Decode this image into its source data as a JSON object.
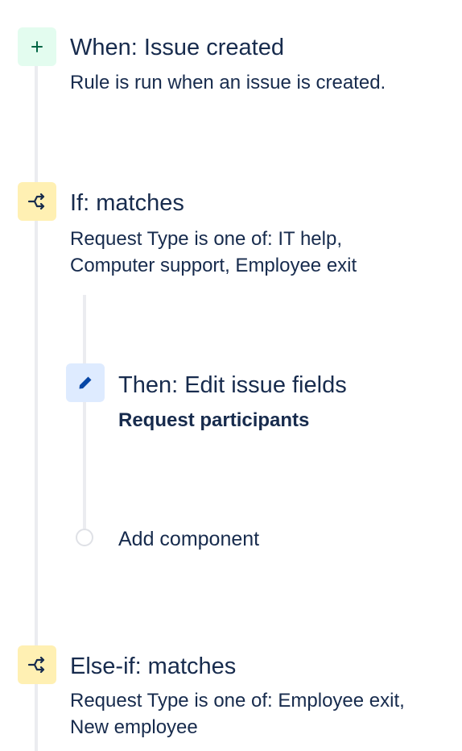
{
  "trigger": {
    "icon": "plus-icon",
    "title": "When: Issue created",
    "description": "Rule is run when an issue is created."
  },
  "condition_if": {
    "icon": "branch-icon",
    "title": "If: matches",
    "description": "Request Type is one of: IT help, Computer support, Employee exit"
  },
  "action_then": {
    "icon": "pencil-icon",
    "title": "Then: Edit issue fields",
    "description": "Request participants"
  },
  "add_component": {
    "label": "Add component"
  },
  "condition_else_if": {
    "icon": "branch-icon",
    "title": "Else-if: matches",
    "description": "Request Type is one of: Employee exit, New employee"
  },
  "colors": {
    "trigger_bg": "#e3fcef",
    "trigger_fg": "#006644",
    "condition_bg": "#fff0b3",
    "action_bg": "#deebff",
    "action_fg": "#0747a6",
    "text": "#172b4d",
    "rail": "#ebecf0"
  }
}
